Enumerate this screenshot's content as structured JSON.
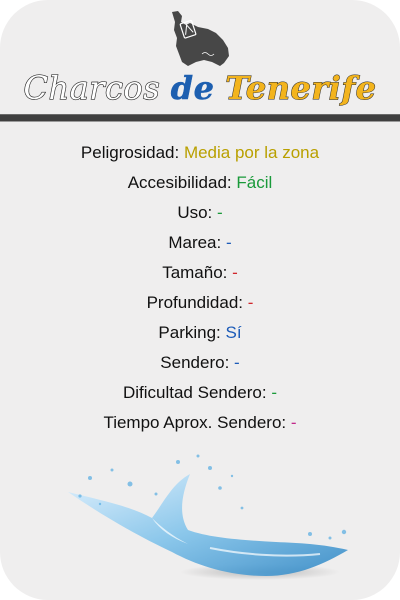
{
  "header": {
    "title_part1": "Charcos",
    "title_part2": "de",
    "title_part3": "Tenerife",
    "logo_icon": "tenerife-island-map-icon"
  },
  "colors": {
    "yellow": "#b9a000",
    "green": "#1a9a3a",
    "blue": "#1c5bb8",
    "red": "#d0272c",
    "magenta": "#c2298a"
  },
  "details": [
    {
      "label": "Peligrosidad:",
      "value": "Media por la zona",
      "color": "#b9a000"
    },
    {
      "label": "Accesibilidad:",
      "value": "Fácil",
      "color": "#1a9a3a"
    },
    {
      "label": "Uso:",
      "value": "-",
      "color": "#1a9a3a"
    },
    {
      "label": "Marea:",
      "value": "-",
      "color": "#1c5bb8"
    },
    {
      "label": "Tamaño:",
      "value": "-",
      "color": "#d0272c"
    },
    {
      "label": "Profundidad:",
      "value": "-",
      "color": "#d0272c"
    },
    {
      "label": "Parking:",
      "value": "Sí",
      "color": "#1c5bb8"
    },
    {
      "label": "Sendero:",
      "value": "-",
      "color": "#1c5bb8"
    },
    {
      "label": "Dificultad Sendero:",
      "value": "-",
      "color": "#1a9a3a"
    },
    {
      "label": "Tiempo Aprox. Sendero:",
      "value": "-",
      "color": "#c2298a"
    }
  ],
  "decoration": {
    "water_icon": "water-splash-icon"
  }
}
